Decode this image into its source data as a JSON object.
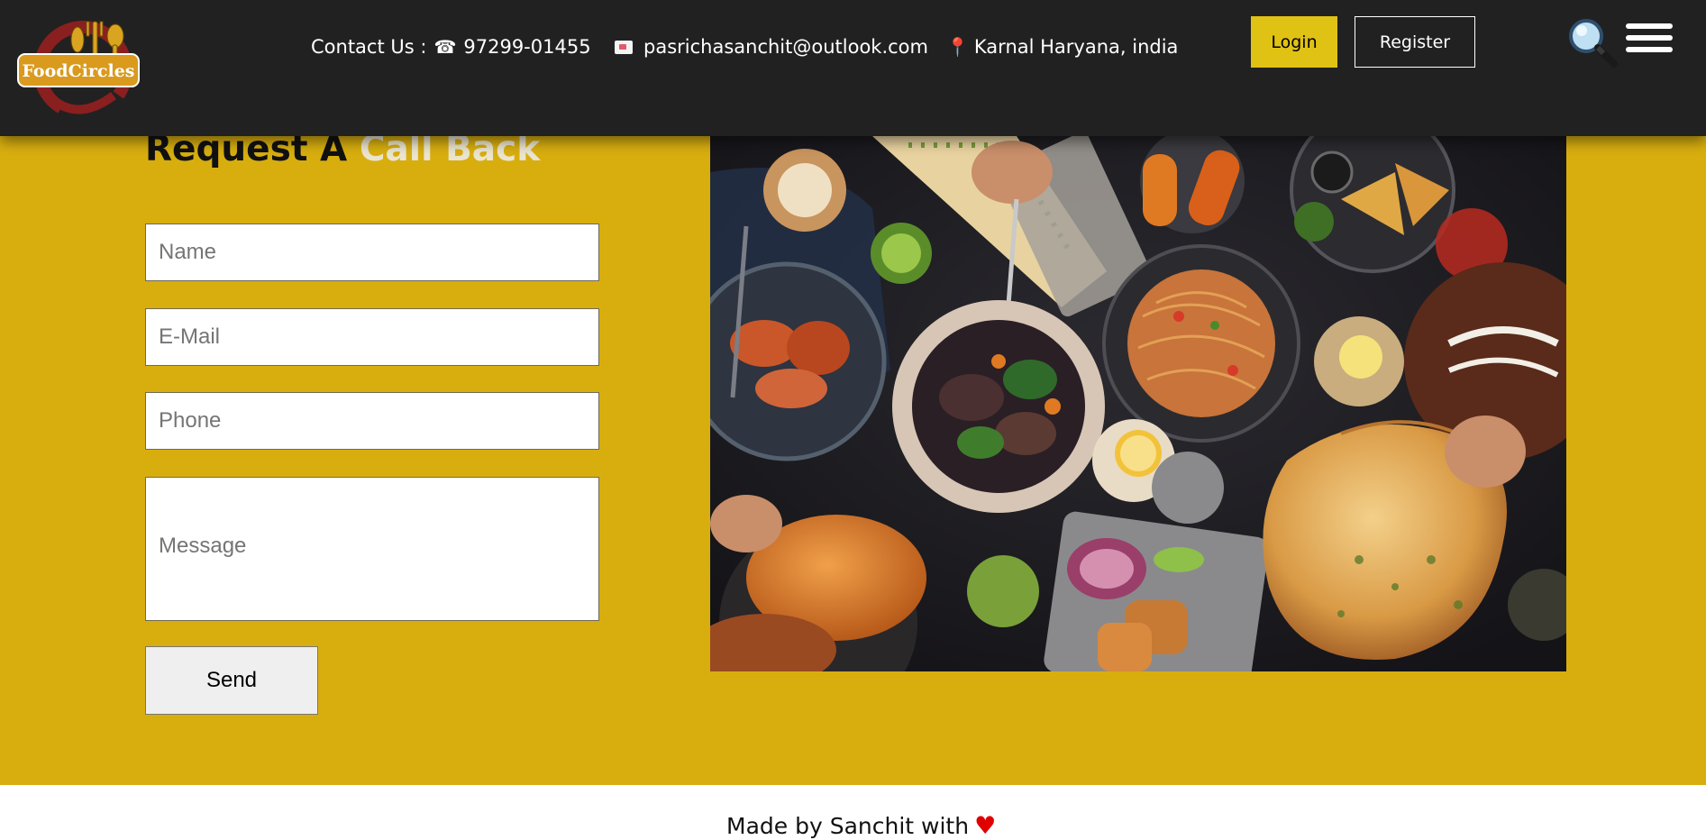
{
  "header": {
    "logo_text": "FoodCircles",
    "contact_label": "Contact Us :",
    "phone_icon": "☎",
    "phone": "97299-01455",
    "email": "pasrichasanchit@outlook.com",
    "location": "Karnal Haryana, india",
    "login_label": "Login",
    "register_label": "Register",
    "search_icon": "magnifier-icon",
    "menu_icon": "hamburger-icon",
    "colors": {
      "background": "#212121",
      "login_bg": "#e0c214"
    }
  },
  "form": {
    "title_part1": "Request A",
    "title_part2": "Call Back",
    "name_placeholder": "Name",
    "email_placeholder": "E-Mail",
    "phone_placeholder": "Phone",
    "message_placeholder": "Message",
    "send_label": "Send",
    "colors": {
      "section_bg": "#d8ae0f",
      "title_accent": "#ebe5cf"
    }
  },
  "image": {
    "subject": "overhead spread of Indian dishes: naan, noodles, curries, samosas, drinks"
  },
  "footer": {
    "text": "Made by Sanchit with",
    "heart": "♥",
    "heart_color": "#e00000"
  }
}
